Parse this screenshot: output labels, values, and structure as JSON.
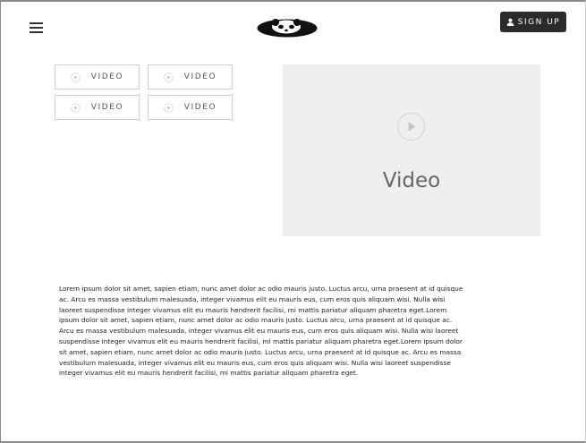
{
  "header": {
    "signup_label": "SIGN UP"
  },
  "video_buttons": [
    {
      "label": "VIDEO"
    },
    {
      "label": "VIDEO"
    },
    {
      "label": "VIDEO"
    },
    {
      "label": "VIDEO"
    }
  ],
  "player": {
    "title": "Video"
  },
  "body_text": "Lorem ipsum dolor sit amet, sapien etiam, nunc amet dolor ac odio mauris justo. Luctus arcu, urna praesent at id quisque ac. Arcu es massa vestibulum malesuada, integer vivamus elit eu mauris eus, cum eros quis aliquam wisi. Nulla wisi laoreet suspendisse integer vivamus elit eu mauris hendrerit facilisi, mi mattis pariatur aliquam pharetra eget.Lorem ipsum dolor sit amet, sapien etiam, nunc amet dolor ac odio mauris justo. Luctus arcu, urna praesent at id quisque ac. Arcu es massa vestibulum malesuada, integer vivamus elit eu mauris eus, cum eros quis aliquam wisi. Nulla wisi laoreet suspendisse integer vivamus elit eu mauris hendrerit facilisi, mi mattis pariatur aliquam pharetra eget.Lorem ipsum dolor sit amet, sapien etiam, nunc amet dolor ac odio mauris justo. Luctus arcu, urna praesent at id quisque ac. Arcu es massa vestibulum malesuada, integer vivamus elit eu mauris eus, cum eros quis aliquam wisi. Nulla wisi laoreet suspendisse integer vivamus elit eu mauris hendrerit facilisi, mi mattis pariatur aliquam pharetra eget.",
  "icons": {
    "menu": "hamburger-menu-icon",
    "logo": "panda-logo",
    "user": "user-icon",
    "play": "play-icon"
  },
  "colors": {
    "signup_bg": "#2b2b2b",
    "player_bg": "#efefef",
    "border": "#cfcfcf"
  }
}
